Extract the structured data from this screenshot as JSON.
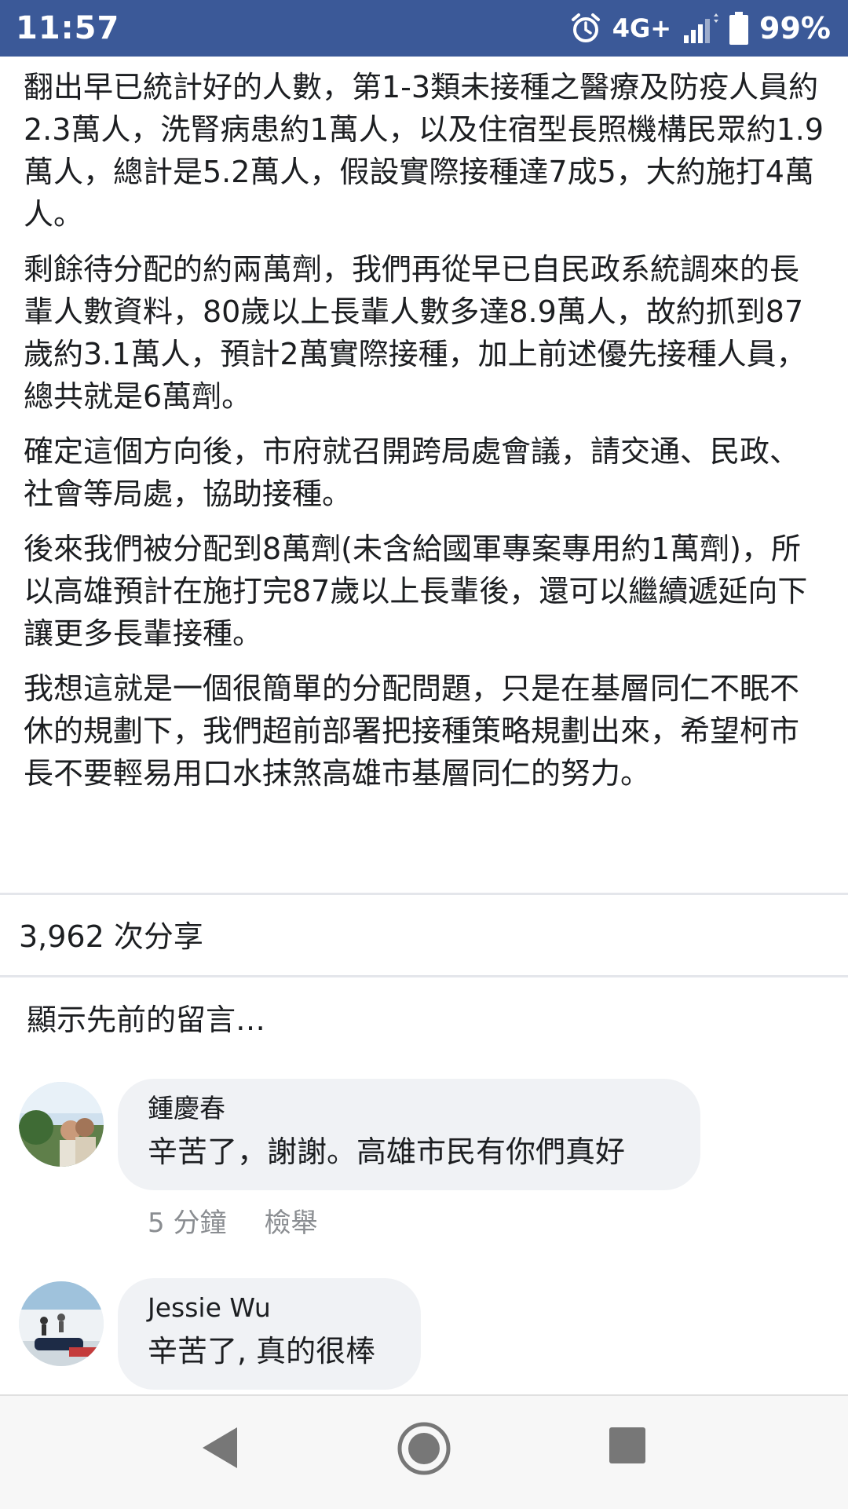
{
  "status_bar": {
    "time": "11:57",
    "network": "4G+",
    "battery": "99%",
    "icons": [
      "alarm-icon",
      "signal-icon",
      "battery-icon"
    ],
    "background": "#3b5998"
  },
  "post": {
    "paragraphs": [
      "翻出早已統計好的人數，第1-3類未接種之醫療及防疫人員約2.3萬人，洗腎病患約1萬人，以及住宿型長照機構民眾約1.9萬人，總計是5.2萬人，假設實際接種達7成5，大約施打4萬人。",
      "剩餘待分配的約兩萬劑，我們再從早已自民政系統調來的長輩人數資料，80歲以上長輩人數多達8.9萬人，故約抓到87歲約3.1萬人，預計2萬實際接種，加上前述優先接種人員，總共就是6萬劑。",
      "確定這個方向後，市府就召開跨局處會議，請交通、民政、社會等局處，協助接種。",
      "後來我們被分配到8萬劑(未含給國軍專案專用約1萬劑)，所以高雄預計在施打完87歲以上長輩後，還可以繼續遞延向下讓更多長輩接種。",
      "我想這就是一個很簡單的分配問題，只是在基層同仁不眠不休的規劃下，我們超前部署把接種策略規劃出來，希望柯市長不要輕易用口水抹煞高雄市基層同仁的努力。"
    ]
  },
  "share_count": "3,962 次分享",
  "previous_comments_link": "顯示先前的留言…",
  "comments": [
    {
      "author": "鍾慶春",
      "text": "辛苦了，謝謝。高雄市民有你們真好",
      "time": "5 分鐘",
      "report": "檢舉"
    },
    {
      "author": "Jessie Wu",
      "text": "辛苦了, 真的很棒"
    }
  ],
  "nav_bar": {
    "icons": [
      "back-icon",
      "home-icon",
      "recents-icon"
    ]
  }
}
